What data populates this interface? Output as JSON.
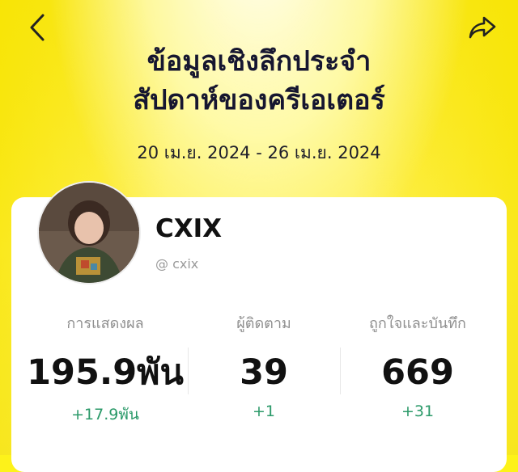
{
  "header": {
    "title_line1": "ข้อมูลเชิงลึกประจำ",
    "title_line2": "สัปดาห์ของครีเอเตอร์",
    "date_range": "20 เม.ย. 2024 - 26 เม.ย. 2024",
    "back_icon": "chevron-left-icon",
    "share_icon": "share-arrow-icon"
  },
  "profile": {
    "name": "CXIX",
    "handle": "@ cxix"
  },
  "stats": [
    {
      "label": "การแสดงผล",
      "value": "195.9พัน",
      "delta": "+17.9พัน"
    },
    {
      "label": "ผู้ติดตาม",
      "value": "39",
      "delta": "+1"
    },
    {
      "label": "ถูกใจและบันทึก",
      "value": "669",
      "delta": "+31"
    }
  ],
  "colors": {
    "background": "#fdf21a",
    "positive": "#2c9a6a"
  }
}
